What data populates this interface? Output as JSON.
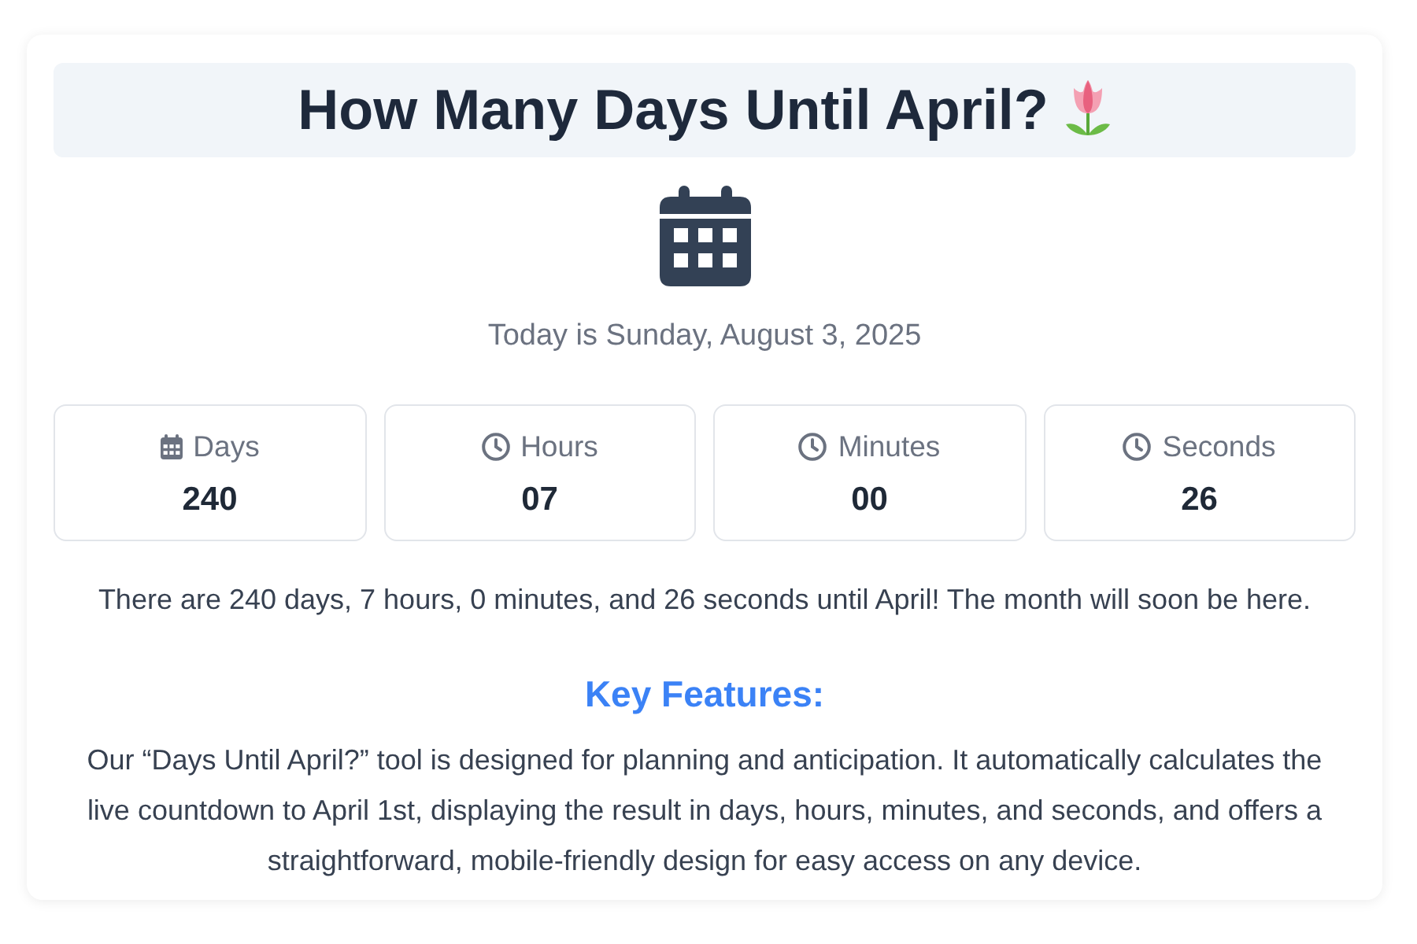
{
  "header": {
    "title": "How Many Days Until April?"
  },
  "today": "Today is Sunday, August 3, 2025",
  "countdown": [
    {
      "kind": "date",
      "label": "Days",
      "value": "240"
    },
    {
      "kind": "time",
      "label": "Hours",
      "value": "07"
    },
    {
      "kind": "time",
      "label": "Minutes",
      "value": "00"
    },
    {
      "kind": "time",
      "label": "Seconds",
      "value": "26"
    }
  ],
  "summary": "There are 240 days, 7 hours, 0 minutes, and 26 seconds until April! The month will soon be here.",
  "features": {
    "heading": "Key Features:",
    "text": "Our “Days Until April?” tool is designed for planning and anticipation. It automatically calculates the live countdown to April 1st, displaying the result in days, hours, minutes, and seconds, and offers a straightforward, mobile-friendly design for easy access on any device."
  }
}
